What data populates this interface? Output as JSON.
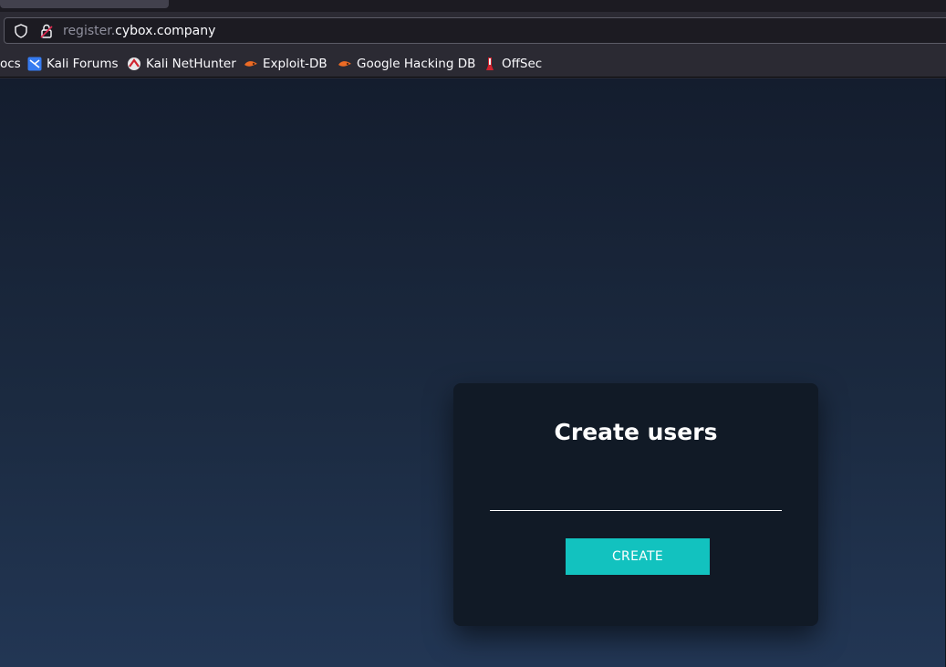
{
  "browser": {
    "url": {
      "subdomain": "register.",
      "domain": "cybox.company"
    },
    "bookmarks": [
      {
        "label": "ocs",
        "icon": "doc-icon"
      },
      {
        "label": "Kali Forums",
        "icon": "kali-forums-icon"
      },
      {
        "label": "Kali NetHunter",
        "icon": "kali-nethunter-icon"
      },
      {
        "label": "Exploit-DB",
        "icon": "exploit-db-icon"
      },
      {
        "label": "Google Hacking DB",
        "icon": "ghdb-icon"
      },
      {
        "label": "OffSec",
        "icon": "offsec-icon"
      }
    ]
  },
  "form": {
    "title": "Create users",
    "input_value": "",
    "button_label": "CREATE"
  },
  "colors": {
    "accent": "#12c2bf",
    "card_bg": "#111a26",
    "page_bg_top": "#141d2e",
    "page_bg_bottom": "#223654"
  }
}
